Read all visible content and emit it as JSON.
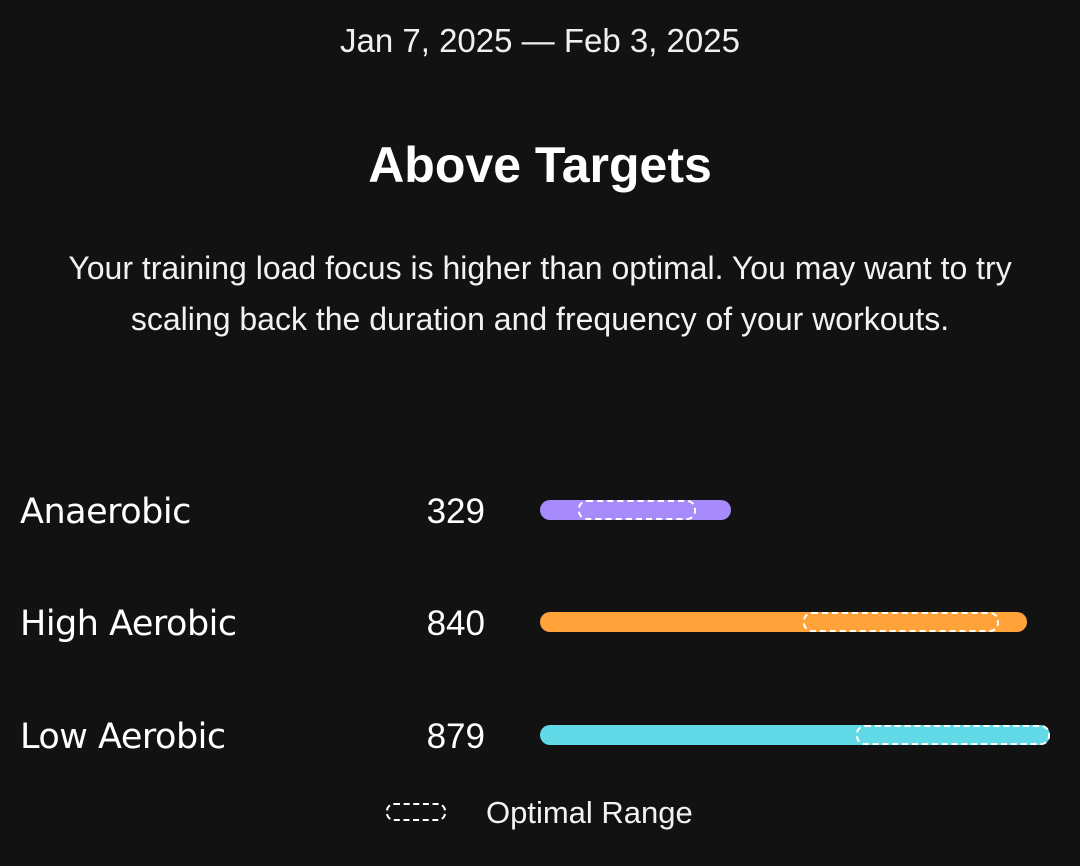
{
  "header": {
    "date_range": "Jan 7, 2025 — Feb 3, 2025",
    "status_title": "Above Targets",
    "description": "Your training load focus is higher than optimal. You may want to try scaling back the duration and frequency of your workouts."
  },
  "load_focus": [
    {
      "label": "Anaerobic",
      "value": "329",
      "color": "#a78bfa"
    },
    {
      "label": "High Aerobic",
      "value": "840",
      "color": "#ffa23a"
    },
    {
      "label": "Low Aerobic",
      "value": "879",
      "color": "#62d9e6"
    }
  ],
  "legend": {
    "label": "Optimal Range"
  }
}
